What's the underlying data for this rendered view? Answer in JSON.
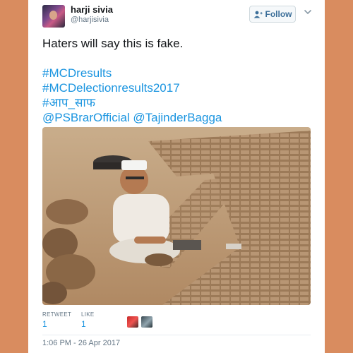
{
  "author": {
    "name": "harji sivia",
    "handle": "@harjisivia"
  },
  "follow_button": {
    "label": "Follow",
    "icon": "add-user-icon"
  },
  "menu_icon": "chevron-down-icon",
  "tweet": {
    "lines": [
      "Haters will say this is fake.",
      "",
      "#MCDresults",
      "#MCDelectionresults2017",
      "#आप_साफ",
      "@PSBrarOfficial @TajinderBagga"
    ]
  },
  "stats": {
    "retweet_label": "RETWEET",
    "retweet_count": "1",
    "like_label": "LIKE",
    "like_count": "1"
  },
  "timestamp": "1:06 PM - 26 Apr 2017",
  "colors": {
    "page_background": "#d98c5f",
    "link": "#1b95e0",
    "text": "#14171a",
    "muted": "#657786"
  }
}
